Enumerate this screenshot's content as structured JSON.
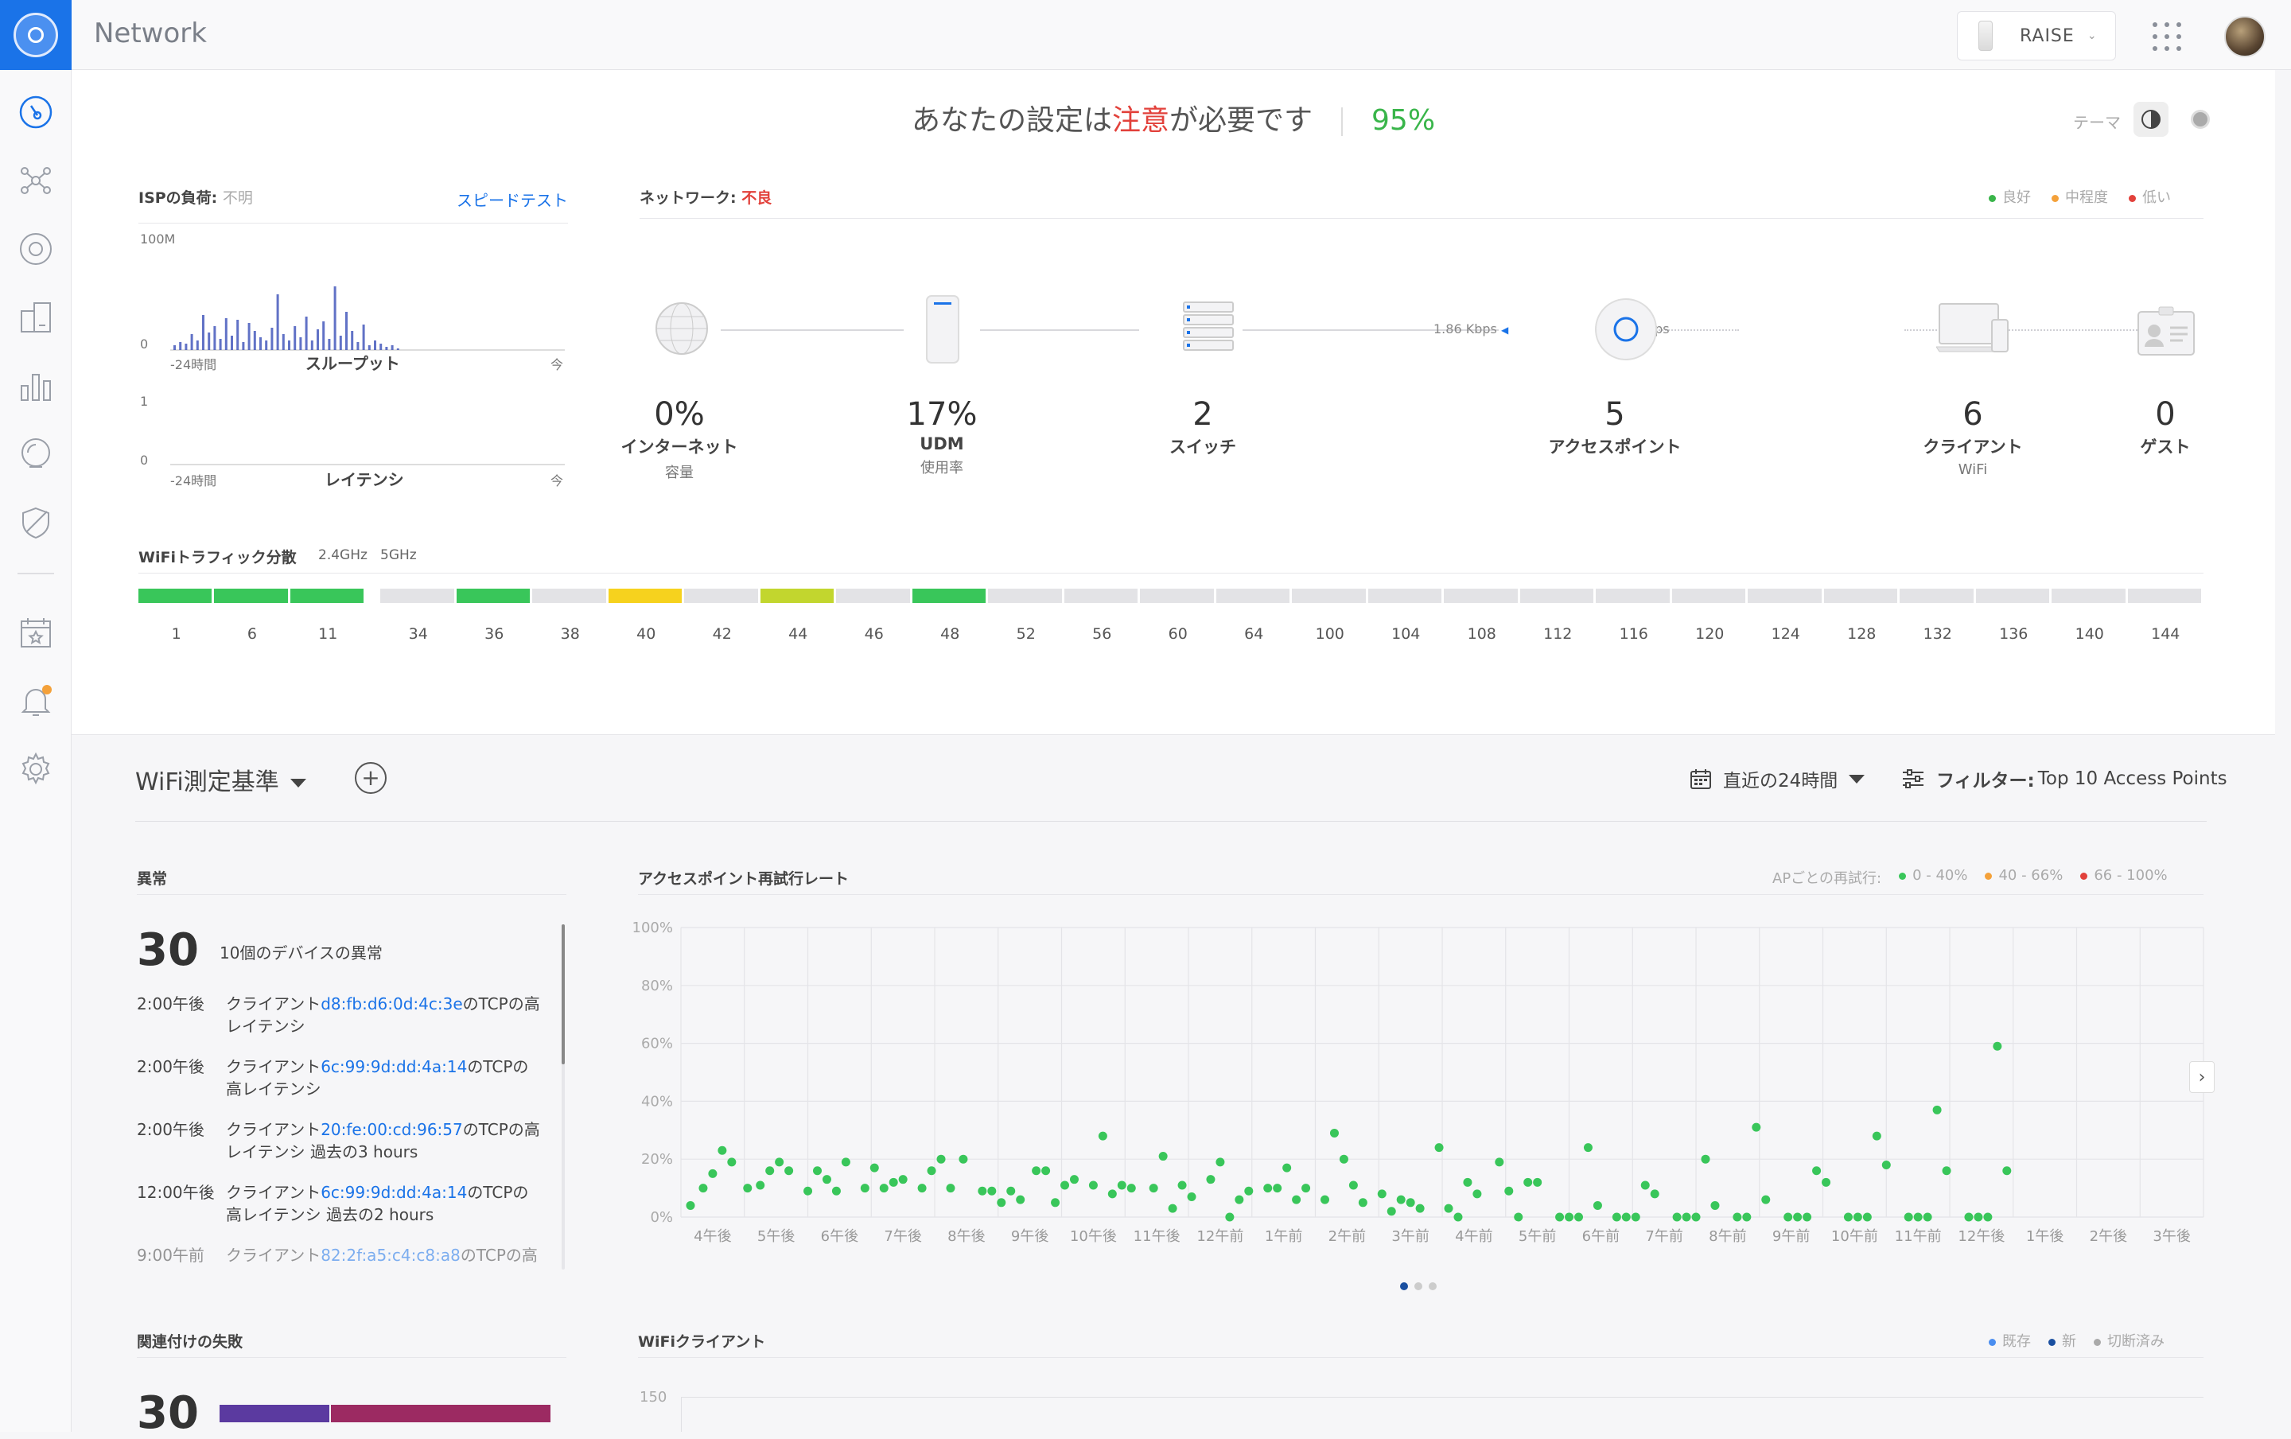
{
  "app": {
    "title": "Network",
    "site": "RAISE"
  },
  "summary": {
    "prefix": "あなたの設定は",
    "warn": "注意",
    "suffix": "が必要です",
    "score": "95%",
    "theme_label": "テーマ"
  },
  "isp": {
    "title": "ISPの負荷:",
    "status": "不明",
    "speedtest": "スピードテスト",
    "throughput": {
      "ymax": "100M",
      "ymin": "0",
      "x_start": "-24時間",
      "x_end": "今",
      "label": "スループット"
    },
    "latency": {
      "ymax": "1",
      "ymin": "0",
      "x_start": "-24時間",
      "x_end": "今",
      "label": "レイテンシ"
    }
  },
  "network": {
    "title": "ネットワーク:",
    "status": "不良",
    "legend": [
      {
        "label": "良好",
        "color": "#39b54a"
      },
      {
        "label": "中程度",
        "color": "#f4a13a"
      },
      {
        "label": "低い",
        "color": "#e2413b"
      }
    ],
    "nodes": [
      {
        "value": "0%",
        "label": "インターネット",
        "sub": "容量"
      },
      {
        "value": "17%",
        "label": "UDM",
        "sub": "使用率"
      },
      {
        "value": "2",
        "label": "スイッチ",
        "sub": ""
      },
      {
        "value": "5",
        "label": "アクセスポイント",
        "sub": ""
      },
      {
        "value": "6",
        "label": "クライアント",
        "sub": "WiFi"
      },
      {
        "value": "0",
        "label": "ゲスト",
        "sub": ""
      }
    ],
    "rate_down": "1.86 Kbps",
    "rate_up": "216 bps"
  },
  "wifi": {
    "title": "WiFiトラフィック分散",
    "band24": "2.4GHz",
    "band5": "5GHz",
    "channels24": [
      {
        "ch": "1",
        "color": "#39c65a"
      },
      {
        "ch": "6",
        "color": "#39c65a"
      },
      {
        "ch": "11",
        "color": "#39c65a"
      }
    ],
    "channels5": [
      {
        "ch": "34",
        "color": "#e3e3e6"
      },
      {
        "ch": "36",
        "color": "#39c65a"
      },
      {
        "ch": "38",
        "color": "#e3e3e6"
      },
      {
        "ch": "40",
        "color": "#f6d21e"
      },
      {
        "ch": "42",
        "color": "#e3e3e6"
      },
      {
        "ch": "44",
        "color": "#c2d62e"
      },
      {
        "ch": "46",
        "color": "#e3e3e6"
      },
      {
        "ch": "48",
        "color": "#39c65a"
      },
      {
        "ch": "52",
        "color": "#e3e3e6"
      },
      {
        "ch": "56",
        "color": "#e3e3e6"
      },
      {
        "ch": "60",
        "color": "#e3e3e6"
      },
      {
        "ch": "64",
        "color": "#e3e3e6"
      },
      {
        "ch": "100",
        "color": "#e3e3e6"
      },
      {
        "ch": "104",
        "color": "#e3e3e6"
      },
      {
        "ch": "108",
        "color": "#e3e3e6"
      },
      {
        "ch": "112",
        "color": "#e3e3e6"
      },
      {
        "ch": "116",
        "color": "#e3e3e6"
      },
      {
        "ch": "120",
        "color": "#e3e3e6"
      },
      {
        "ch": "124",
        "color": "#e3e3e6"
      },
      {
        "ch": "128",
        "color": "#e3e3e6"
      },
      {
        "ch": "132",
        "color": "#e3e3e6"
      },
      {
        "ch": "136",
        "color": "#e3e3e6"
      },
      {
        "ch": "140",
        "color": "#e3e3e6"
      },
      {
        "ch": "144",
        "color": "#e3e3e6"
      }
    ]
  },
  "metrics": {
    "title": "WiFi測定基準",
    "time_range": "直近の24時間",
    "filter_label": "フィルター:",
    "filter_value": "Top 10 Access Points"
  },
  "anomalies": {
    "title": "異常",
    "count": "30",
    "desc": "10個のデバイスの異常",
    "items": [
      {
        "time": "2:00午後",
        "pre": "クライアント",
        "mac": "d8:fb:d6:0d:4c:3e",
        "post": "のTCPの高レイテンシ"
      },
      {
        "time": "2:00午後",
        "pre": "クライアント",
        "mac": "6c:99:9d:dd:4a:14",
        "post": "のTCPの高レイテンシ"
      },
      {
        "time": "2:00午後",
        "pre": "クライアント",
        "mac": "20:fe:00:cd:96:57",
        "post": "のTCPの高レイテンシ 過去の3 hours"
      },
      {
        "time": "12:00午後",
        "pre": "クライアント",
        "mac": "6c:99:9d:dd:4a:14",
        "post": "のTCPの高レイテンシ 過去の2 hours"
      },
      {
        "time": "9:00午前",
        "pre": "クライアント",
        "mac": "82:2f:a5:c4:c8:a8",
        "post": "のTCPの高レイ"
      }
    ]
  },
  "retry": {
    "title": "アクセスポイント再試行レート",
    "legend_title": "APごとの再試行:",
    "legend": [
      {
        "label": "0 - 40%",
        "color": "#39c65a"
      },
      {
        "label": "40 - 66%",
        "color": "#f4a13a"
      },
      {
        "label": "66 - 100%",
        "color": "#e2413b"
      }
    ]
  },
  "failures": {
    "title": "関連付けの失敗",
    "count": "30"
  },
  "wifi_clients": {
    "title": "WiFiクライアント",
    "legend": [
      {
        "label": "既存",
        "color": "#4b8ef0"
      },
      {
        "label": "新",
        "color": "#1a4fa0"
      },
      {
        "label": "切断済み",
        "color": "#aaaaaa"
      }
    ],
    "ymax": "150"
  },
  "chart_data": {
    "type": "scatter",
    "title": "アクセスポイント再試行レート",
    "ylim": [
      0,
      100
    ],
    "y_ticks": [
      "0%",
      "20%",
      "40%",
      "60%",
      "80%",
      "100%"
    ],
    "categories": [
      "4午後",
      "5午後",
      "6午後",
      "7午後",
      "8午後",
      "9午後",
      "10午後",
      "11午後",
      "12午前",
      "1午前",
      "2午前",
      "3午前",
      "4午前",
      "5午前",
      "6午前",
      "7午前",
      "8午前",
      "9午前",
      "10午前",
      "11午前",
      "12午後",
      "1午後",
      "2午後",
      "3午後"
    ],
    "series": [
      {
        "color": "#39c65a",
        "points": [
          [
            0.0,
            4
          ],
          [
            0.2,
            10
          ],
          [
            0.35,
            15
          ],
          [
            0.5,
            23
          ],
          [
            0.65,
            19
          ],
          [
            0.9,
            10
          ],
          [
            1.1,
            11
          ],
          [
            1.25,
            16
          ],
          [
            1.4,
            19
          ],
          [
            1.55,
            16
          ],
          [
            1.85,
            9
          ],
          [
            2.0,
            16
          ],
          [
            2.15,
            13
          ],
          [
            2.3,
            9
          ],
          [
            2.45,
            19
          ],
          [
            2.75,
            10
          ],
          [
            2.9,
            17
          ],
          [
            3.05,
            10
          ],
          [
            3.2,
            12
          ],
          [
            3.35,
            13
          ],
          [
            3.65,
            10
          ],
          [
            3.8,
            16
          ],
          [
            3.95,
            20
          ],
          [
            4.1,
            10
          ],
          [
            4.3,
            20
          ],
          [
            4.6,
            9
          ],
          [
            4.75,
            9
          ],
          [
            4.9,
            5
          ],
          [
            5.05,
            9
          ],
          [
            5.2,
            6
          ],
          [
            5.45,
            16
          ],
          [
            5.6,
            16
          ],
          [
            5.75,
            5
          ],
          [
            5.9,
            11
          ],
          [
            6.05,
            13
          ],
          [
            6.35,
            11
          ],
          [
            6.5,
            28
          ],
          [
            6.65,
            8
          ],
          [
            6.8,
            11
          ],
          [
            6.95,
            10
          ],
          [
            7.3,
            10
          ],
          [
            7.45,
            21
          ],
          [
            7.6,
            3
          ],
          [
            7.75,
            11
          ],
          [
            7.9,
            7
          ],
          [
            8.2,
            13
          ],
          [
            8.35,
            19
          ],
          [
            8.5,
            0
          ],
          [
            8.65,
            6
          ],
          [
            8.8,
            9
          ],
          [
            9.1,
            10
          ],
          [
            9.25,
            10
          ],
          [
            9.4,
            17
          ],
          [
            9.55,
            6
          ],
          [
            9.7,
            10
          ],
          [
            10.0,
            6
          ],
          [
            10.15,
            29
          ],
          [
            10.3,
            20
          ],
          [
            10.45,
            11
          ],
          [
            10.6,
            5
          ],
          [
            10.9,
            8
          ],
          [
            11.05,
            2
          ],
          [
            11.2,
            6
          ],
          [
            11.35,
            5
          ],
          [
            11.5,
            3
          ],
          [
            11.8,
            24
          ],
          [
            11.95,
            3
          ],
          [
            12.1,
            0
          ],
          [
            12.25,
            12
          ],
          [
            12.4,
            8
          ],
          [
            12.75,
            19
          ],
          [
            12.9,
            9
          ],
          [
            13.05,
            0
          ],
          [
            13.2,
            12
          ],
          [
            13.35,
            12
          ],
          [
            13.7,
            0
          ],
          [
            13.85,
            0
          ],
          [
            14.0,
            0
          ],
          [
            14.15,
            24
          ],
          [
            14.3,
            4
          ],
          [
            14.6,
            0
          ],
          [
            14.75,
            0
          ],
          [
            14.9,
            0
          ],
          [
            15.05,
            11
          ],
          [
            15.2,
            8
          ],
          [
            15.55,
            0
          ],
          [
            15.7,
            0
          ],
          [
            15.85,
            0
          ],
          [
            16.0,
            20
          ],
          [
            16.15,
            4
          ],
          [
            16.5,
            0
          ],
          [
            16.65,
            0
          ],
          [
            16.8,
            31
          ],
          [
            16.95,
            6
          ],
          [
            17.3,
            0
          ],
          [
            17.45,
            0
          ],
          [
            17.6,
            0
          ],
          [
            17.75,
            16
          ],
          [
            17.9,
            12
          ],
          [
            18.25,
            0
          ],
          [
            18.4,
            0
          ],
          [
            18.55,
            0
          ],
          [
            18.7,
            28
          ],
          [
            18.85,
            18
          ],
          [
            19.2,
            0
          ],
          [
            19.35,
            0
          ],
          [
            19.5,
            0
          ],
          [
            19.65,
            37
          ],
          [
            19.8,
            16
          ],
          [
            20.15,
            0
          ],
          [
            20.3,
            0
          ],
          [
            20.45,
            0
          ],
          [
            20.6,
            59
          ],
          [
            20.75,
            16
          ]
        ]
      }
    ]
  }
}
